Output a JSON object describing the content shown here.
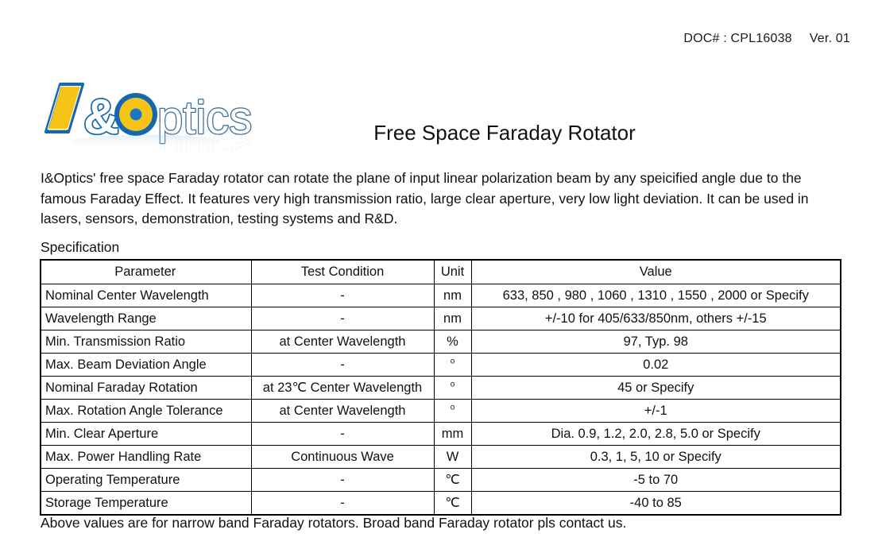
{
  "header": {
    "doc_number": "DOC# : CPL16038",
    "version": "Ver. 01"
  },
  "logo": {
    "alt_text": "I&Optics",
    "word_mark": "I&Optics",
    "colors": {
      "blue": "#1667b1",
      "blue_dark": "#14558f",
      "yellow": "#f6c416",
      "outline_text": "#3d6f96"
    }
  },
  "title": "Free Space Faraday Rotator",
  "intro": "I&Optics' free space Faraday rotator can rotate the plane of input linear polarization beam by any speicified angle due to the famous Faraday Effect. It features very high transmission ratio, large clear aperture, very low light deviation. It can be used in lasers, sensors, demonstration, testing systems and R&D.",
  "spec_label": "Specification",
  "table": {
    "columns": [
      "Parameter",
      "Test Condition",
      "Unit",
      "Value"
    ],
    "rows": [
      {
        "parameter": "Nominal Center Wavelength",
        "test_condition": "-",
        "unit": "nm",
        "value": "633, 850 , 980 , 1060 , 1310 , 1550 , 2000 or Specify"
      },
      {
        "parameter": "Wavelength Range",
        "test_condition": "-",
        "unit": "nm",
        "value": "+/-10 for 405/633/850nm, others +/-15"
      },
      {
        "parameter": "Min. Transmission Ratio",
        "test_condition": "at Center Wavelength",
        "unit": "%",
        "value": "97, Typ. 98"
      },
      {
        "parameter": "Max. Beam Deviation Angle",
        "test_condition": "-",
        "unit": "o",
        "value": "0.02"
      },
      {
        "parameter": "Nominal Faraday Rotation",
        "test_condition": "at 23℃ Center Wavelength",
        "unit": "o",
        "value": "45 or Specify"
      },
      {
        "parameter": "Max. Rotation Angle Tolerance",
        "test_condition": "at Center Wavelength",
        "unit": "o",
        "value": "+/-1"
      },
      {
        "parameter": "Min. Clear Aperture",
        "test_condition": "-",
        "unit": "mm",
        "value": "Dia. 0.9, 1.2, 2.0, 2.8, 5.0 or Specify"
      },
      {
        "parameter": "Max. Power Handling Rate",
        "test_condition": "Continuous Wave",
        "unit": "W",
        "value": "0.3, 1, 5, 10 or Specify"
      },
      {
        "parameter": "Operating Temperature",
        "test_condition": "-",
        "unit": "℃",
        "value": "-5 to 70"
      },
      {
        "parameter": "Storage Temperature",
        "test_condition": "-",
        "unit": "℃",
        "value": "-40 to 85"
      }
    ]
  },
  "footnote": "Above values are for narrow band Faraday rotators. Broad band Faraday rotator pls contact us."
}
